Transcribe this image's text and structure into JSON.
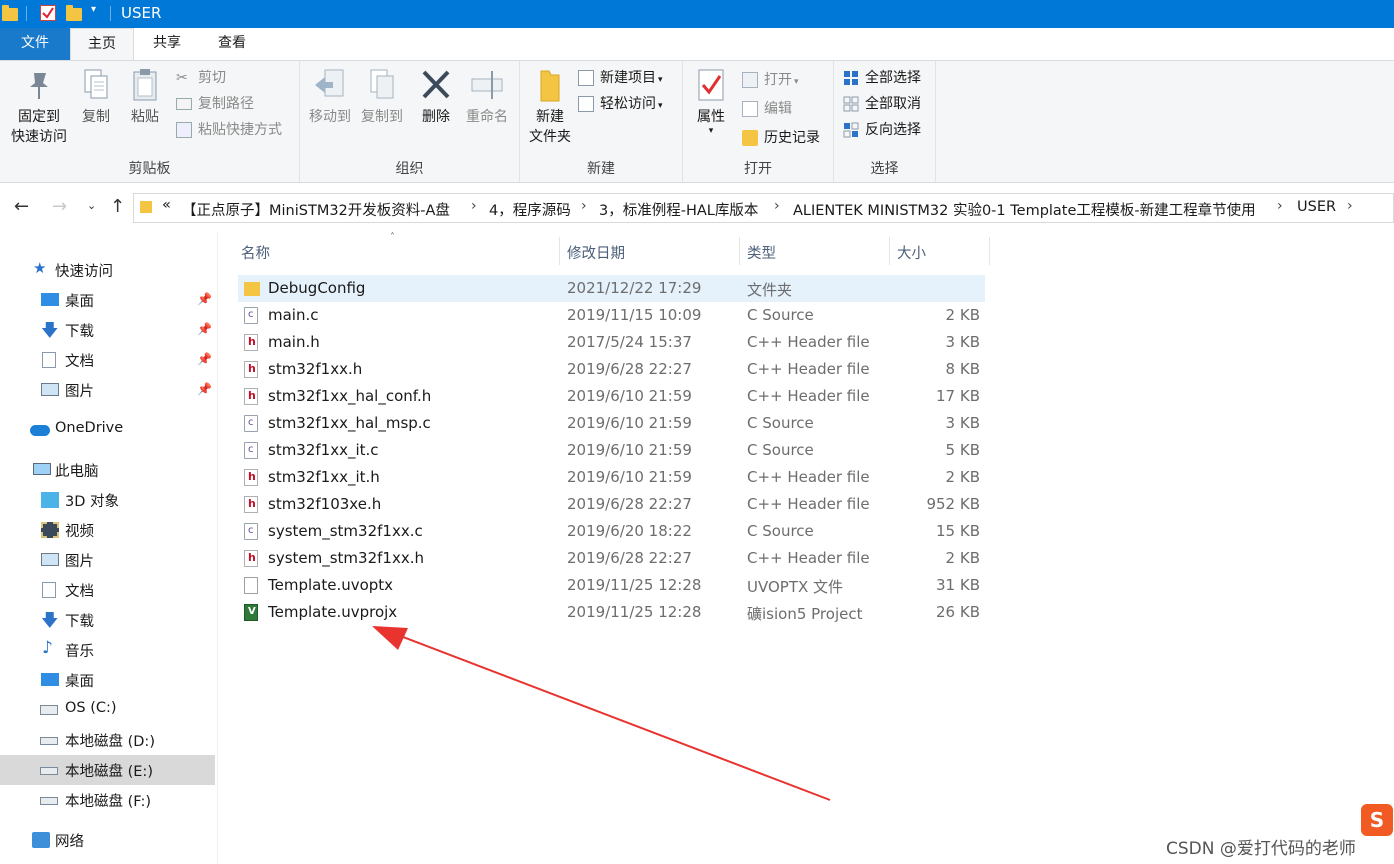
{
  "window": {
    "title": "USER"
  },
  "tabs": [
    {
      "label": "文件"
    },
    {
      "label": "主页"
    },
    {
      "label": "共享"
    },
    {
      "label": "查看"
    }
  ],
  "ribbon": {
    "clipboard": {
      "pin_label_1": "固定到",
      "pin_label_2": "快速访问",
      "copy": "复制",
      "paste": "粘贴",
      "cut": "剪切",
      "copy_path": "复制路径",
      "paste_shortcut": "粘贴快捷方式",
      "group": "剪贴板"
    },
    "organize": {
      "move_to": "移动到",
      "copy_to": "复制到",
      "delete": "删除",
      "rename": "重命名",
      "group": "组织"
    },
    "new": {
      "new_folder_1": "新建",
      "new_folder_2": "文件夹",
      "new_item": "新建项目",
      "easy_access": "轻松访问",
      "group": "新建"
    },
    "open": {
      "properties": "属性",
      "open": "打开",
      "edit": "编辑",
      "history": "历史记录",
      "group": "打开"
    },
    "select": {
      "select_all": "全部选择",
      "select_none": "全部取消",
      "invert": "反向选择",
      "group": "选择"
    }
  },
  "address": {
    "overflow": "«",
    "crumbs": [
      "【正点原子】MiniSTM32开发板资料-A盘",
      "4，程序源码",
      "3，标准例程-HAL库版本",
      "ALIENTEK MINISTM32 实验0-1 Template工程模板-新建工程章节使用",
      "USER"
    ],
    "chevron": "›"
  },
  "sidebar": {
    "quick_access": "快速访问",
    "quick_items": [
      {
        "label": "桌面"
      },
      {
        "label": "下载"
      },
      {
        "label": "文档"
      },
      {
        "label": "图片"
      }
    ],
    "onedrive": "OneDrive",
    "this_pc": "此电脑",
    "pc_items": [
      {
        "label": "3D 对象"
      },
      {
        "label": "视频"
      },
      {
        "label": "图片"
      },
      {
        "label": "文档"
      },
      {
        "label": "下载"
      },
      {
        "label": "音乐"
      },
      {
        "label": "桌面"
      },
      {
        "label": "OS (C:)"
      },
      {
        "label": "本地磁盘 (D:)"
      },
      {
        "label": "本地磁盘 (E:)"
      },
      {
        "label": "本地磁盘 (F:)"
      }
    ],
    "network": "网络"
  },
  "columns": {
    "name": "名称",
    "modified": "修改日期",
    "type": "类型",
    "size": "大小"
  },
  "files": [
    {
      "name": "DebugConfig",
      "date": "2021/12/22 17:29",
      "type": "文件夹",
      "size": "",
      "icon": "folder-icon"
    },
    {
      "name": "main.c",
      "date": "2019/11/15 10:09",
      "type": "C Source",
      "size": "2 KB",
      "icon": "c-file-icon"
    },
    {
      "name": "main.h",
      "date": "2017/5/24 15:37",
      "type": "C++ Header file",
      "size": "3 KB",
      "icon": "h-file-icon"
    },
    {
      "name": "stm32f1xx.h",
      "date": "2019/6/28 22:27",
      "type": "C++ Header file",
      "size": "8 KB",
      "icon": "h-file-icon"
    },
    {
      "name": "stm32f1xx_hal_conf.h",
      "date": "2019/6/10 21:59",
      "type": "C++ Header file",
      "size": "17 KB",
      "icon": "h-file-icon"
    },
    {
      "name": "stm32f1xx_hal_msp.c",
      "date": "2019/6/10 21:59",
      "type": "C Source",
      "size": "3 KB",
      "icon": "c-file-icon"
    },
    {
      "name": "stm32f1xx_it.c",
      "date": "2019/6/10 21:59",
      "type": "C Source",
      "size": "5 KB",
      "icon": "c-file-icon"
    },
    {
      "name": "stm32f1xx_it.h",
      "date": "2019/6/10 21:59",
      "type": "C++ Header file",
      "size": "2 KB",
      "icon": "h-file-icon"
    },
    {
      "name": "stm32f103xe.h",
      "date": "2019/6/28 22:27",
      "type": "C++ Header file",
      "size": "952 KB",
      "icon": "h-file-icon"
    },
    {
      "name": "system_stm32f1xx.c",
      "date": "2019/6/20 18:22",
      "type": "C Source",
      "size": "15 KB",
      "icon": "c-file-icon"
    },
    {
      "name": "system_stm32f1xx.h",
      "date": "2019/6/28 22:27",
      "type": "C++ Header file",
      "size": "2 KB",
      "icon": "h-file-icon"
    },
    {
      "name": "Template.uvoptx",
      "date": "2019/11/25 12:28",
      "type": "UVOPTX 文件",
      "size": "31 KB",
      "icon": "blank-file-icon"
    },
    {
      "name": "Template.uvprojx",
      "date": "2019/11/25 12:28",
      "type": "礦ision5 Project",
      "size": "26 KB",
      "icon": "uvision-project-icon"
    }
  ],
  "watermark": "CSDN @爱打代码的老师",
  "colors": {
    "accent": "#0078d7",
    "selected_row": "#e5f1fb",
    "arrow": "#e8332f"
  }
}
